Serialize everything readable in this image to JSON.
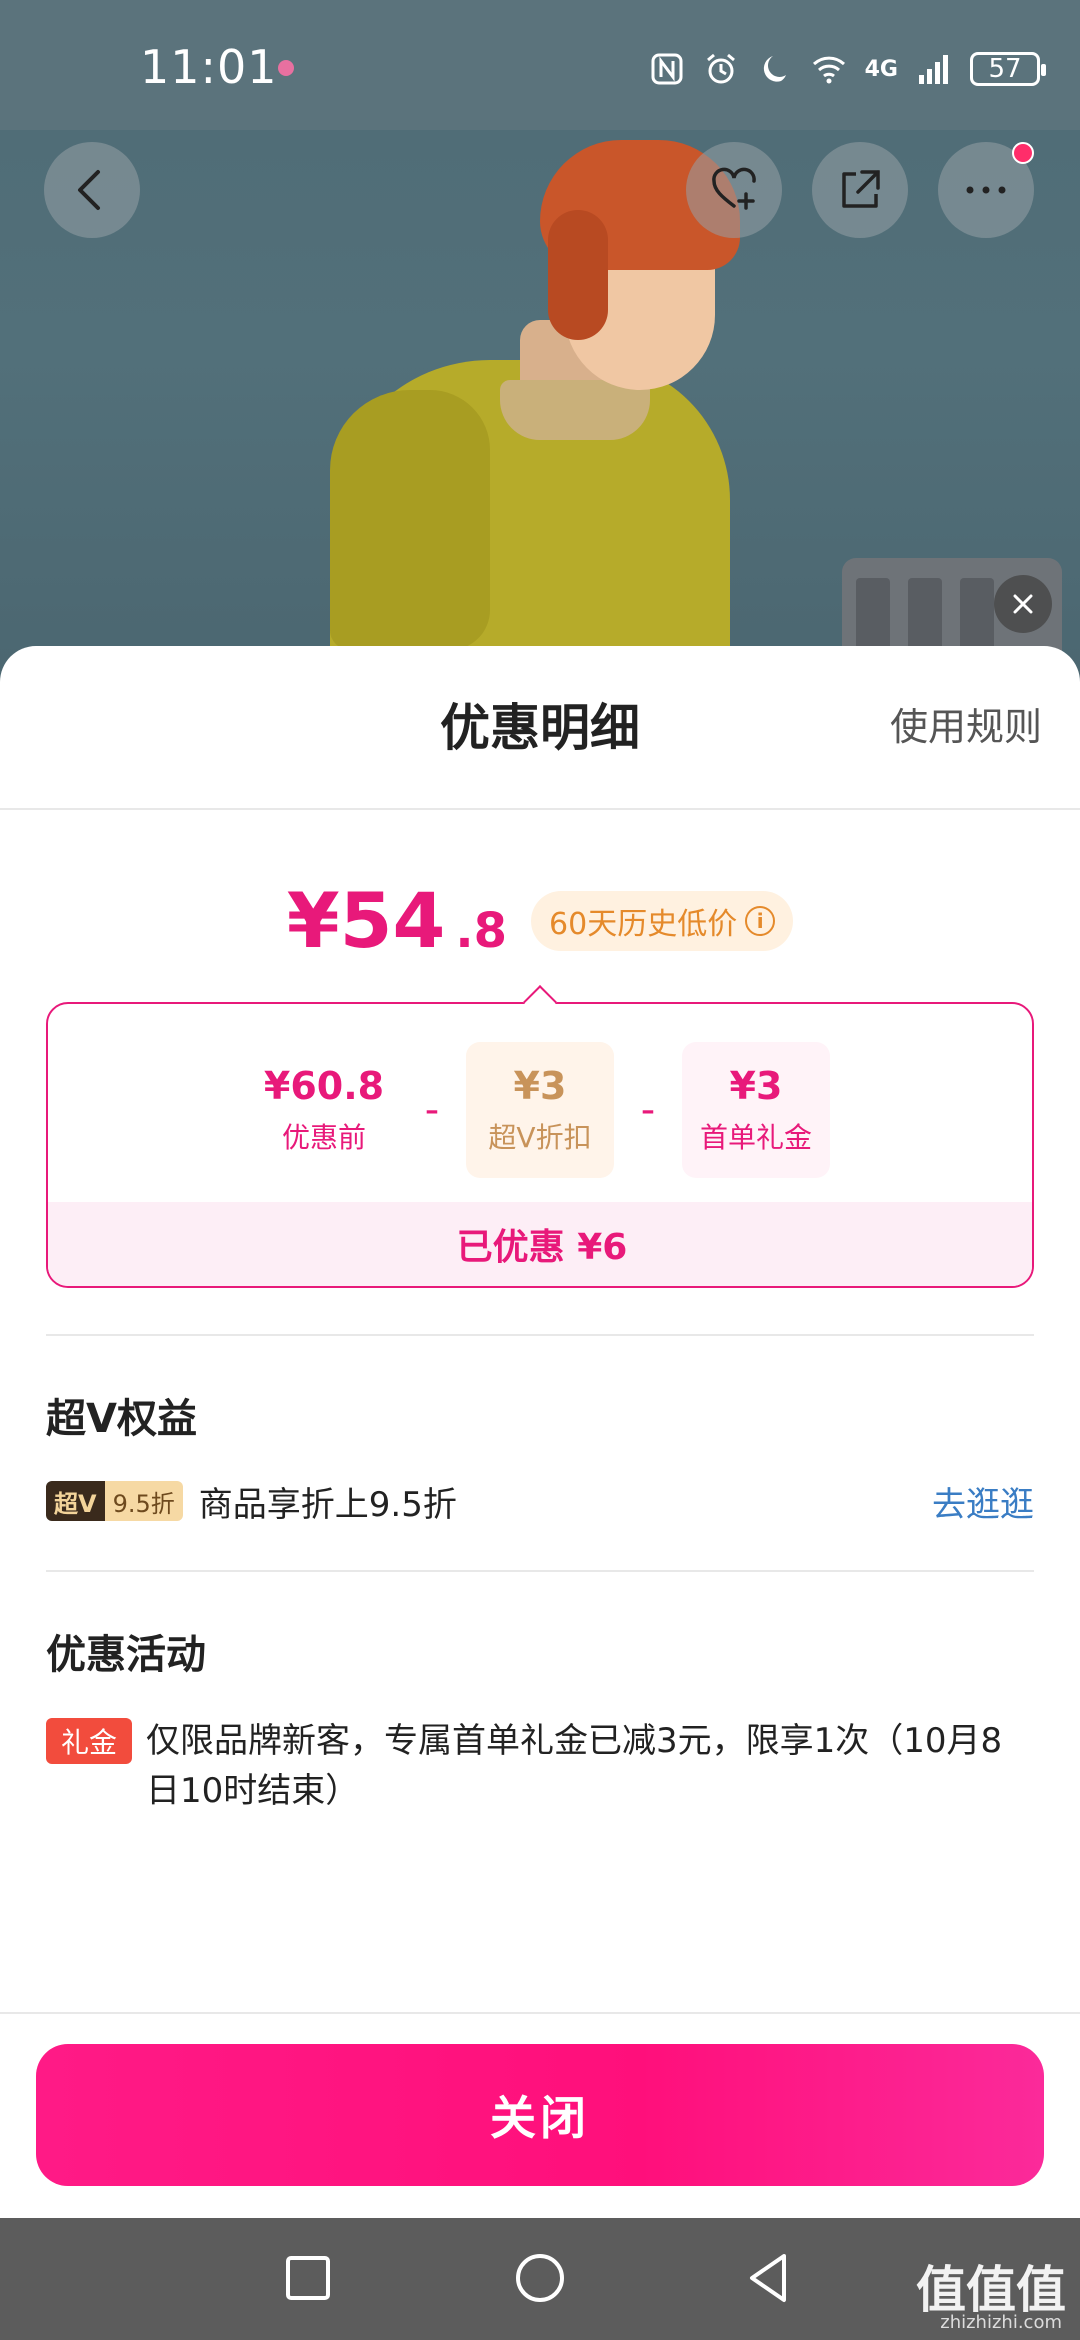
{
  "status_bar": {
    "time": "11:01",
    "network": "4G",
    "battery": "57"
  },
  "header_icons": [
    "back-icon",
    "favorite-add-icon",
    "share-icon",
    "more-icon"
  ],
  "sheet": {
    "title": "优惠明细",
    "rules_link": "使用规则",
    "price": {
      "integer": "¥54",
      "decimal": ".8",
      "tag": "60天历史低价"
    },
    "breakdown": {
      "items": [
        {
          "value": "¥60.8",
          "label": "优惠前"
        },
        {
          "value": "¥3",
          "label": "超V折扣"
        },
        {
          "value": "¥3",
          "label": "首单礼金"
        }
      ],
      "operator": "-",
      "saved": "已优惠 ¥6"
    },
    "vip_section": {
      "title": "超V权益",
      "badge_left": "超V",
      "badge_right": "9.5折",
      "text": "商品享折上9.5折",
      "link": "去逛逛"
    },
    "promo_section": {
      "title": "优惠活动",
      "tag": "礼金",
      "text": "仅限品牌新客，专属首单礼金已减3元，限享1次（10月8日10时结束）"
    },
    "close_button": "关闭"
  },
  "watermark": {
    "main": "值值值",
    "sub": "zhizhizhi.com"
  },
  "colors": {
    "accent": "#e8197a",
    "close_button": "#ff0f7b",
    "vip_gold": "#c8935a",
    "gift_red": "#f24c3d",
    "link_blue": "#3a7dc4"
  }
}
